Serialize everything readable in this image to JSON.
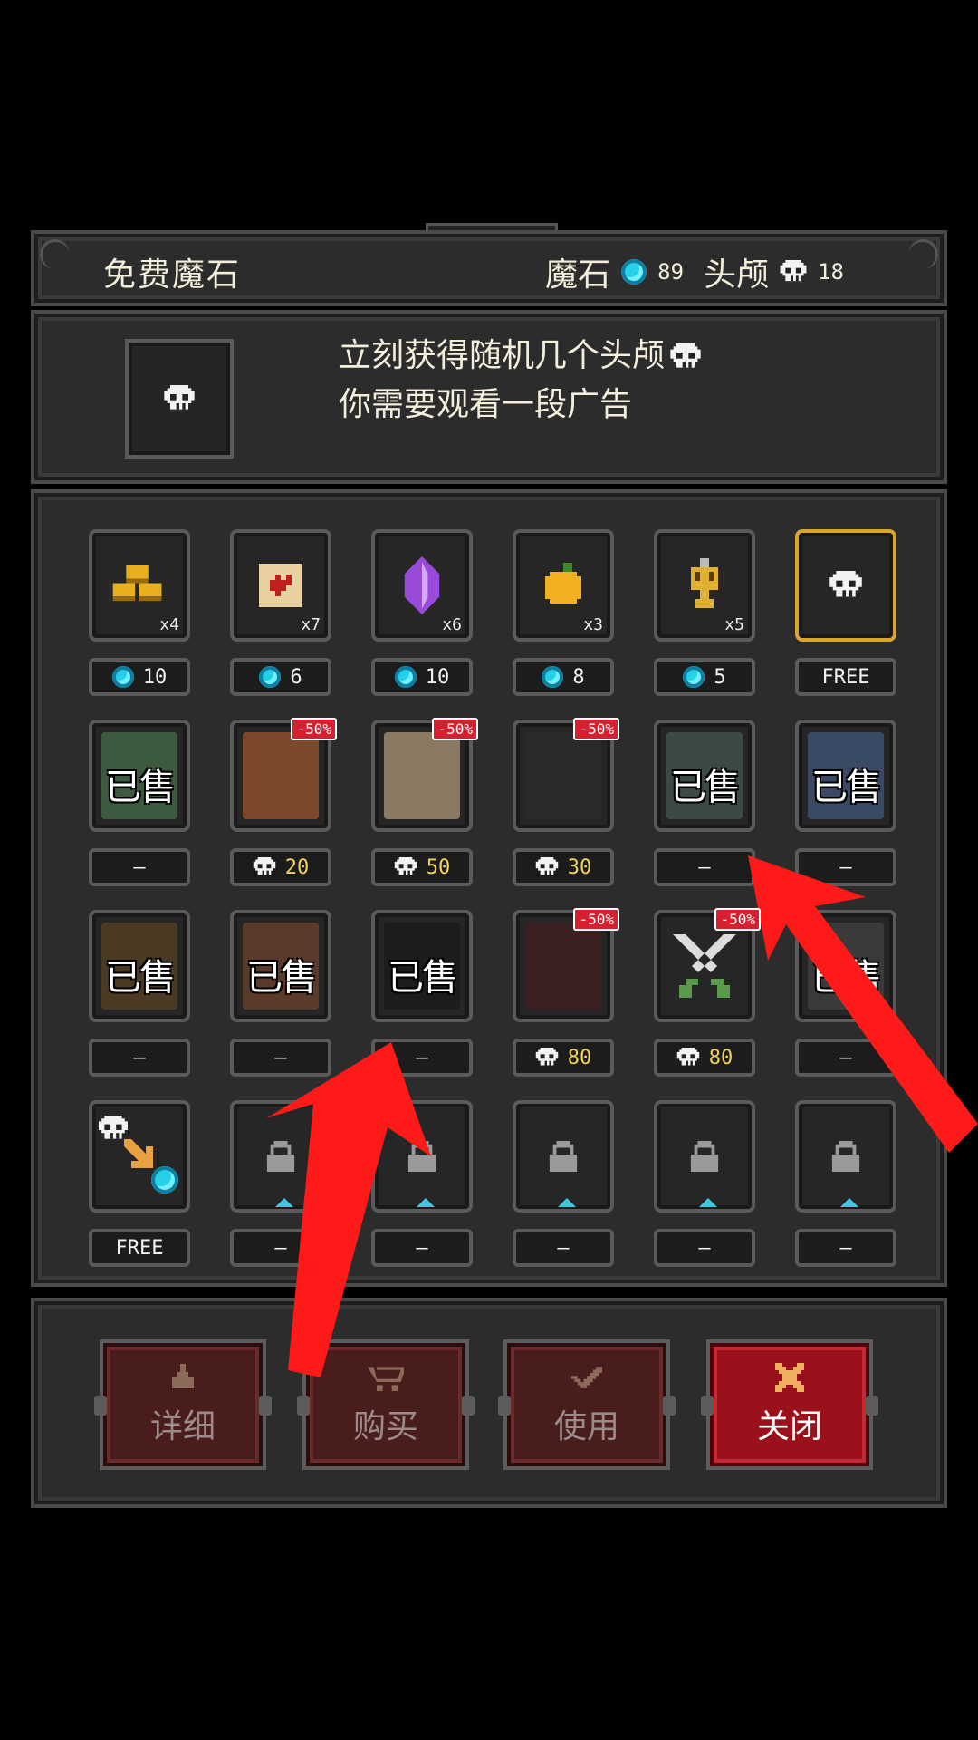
{
  "header": {
    "title": "免费魔石",
    "gem_label": "魔石",
    "gem_count": "89",
    "skull_label": "头颅",
    "skull_count": "18"
  },
  "ad": {
    "line1": "立刻获得随机几个头颅",
    "line2": "你需要观看一段广告"
  },
  "grid": {
    "rows": [
      [
        {
          "icon": "gold-bars-icon",
          "count": "x4",
          "price": "10",
          "currency": "gem"
        },
        {
          "icon": "scroll-heart-icon",
          "count": "x7",
          "price": "6",
          "currency": "gem"
        },
        {
          "icon": "purple-crystal-icon",
          "count": "x6",
          "price": "10",
          "currency": "gem"
        },
        {
          "icon": "golden-apple-icon",
          "count": "x3",
          "price": "8",
          "currency": "gem"
        },
        {
          "icon": "golden-skull-key-icon",
          "count": "x5",
          "price": "5",
          "currency": "gem"
        },
        {
          "icon": "skull-icon",
          "count": "",
          "price": "FREE",
          "currency": "none",
          "selected": true
        }
      ],
      [
        {
          "icon": "green-slime-portrait",
          "sold": "已售",
          "price": "—"
        },
        {
          "icon": "tree-monster-portrait",
          "badge": "-50%",
          "price": "20",
          "currency": "skull"
        },
        {
          "icon": "skeleton-knight-portrait",
          "badge": "-50%",
          "price": "50",
          "currency": "skull"
        },
        {
          "icon": "dark-reaper-portrait",
          "badge": "-50%",
          "price": "30",
          "currency": "skull"
        },
        {
          "icon": "green-haired-girl-portrait",
          "sold": "已售",
          "price": "—"
        },
        {
          "icon": "blue-mage-girl-portrait",
          "sold": "已售",
          "price": "—"
        }
      ],
      [
        {
          "icon": "forest-ent-portrait",
          "sold": "已售",
          "price": "—"
        },
        {
          "icon": "blonde-vampire-portrait",
          "sold": "已售",
          "price": "—"
        },
        {
          "icon": "shadow-wraith-portrait",
          "sold": "已售",
          "price": "—"
        },
        {
          "icon": "pirate-captain-portrait",
          "badge": "-50%",
          "price": "80",
          "currency": "skull"
        },
        {
          "icon": "crossed-swords-icon",
          "badge": "-50%",
          "price": "80",
          "currency": "skull"
        },
        {
          "icon": "hooded-figure-portrait",
          "sold": "已售",
          "price": "—"
        }
      ],
      [
        {
          "icon": "skull-to-gem-exchange-icon",
          "price": "FREE",
          "currency": "none"
        },
        {
          "icon": "lock-icon",
          "locked": true,
          "price": "—"
        },
        {
          "icon": "lock-icon",
          "locked": true,
          "price": "—"
        },
        {
          "icon": "lock-icon",
          "locked": true,
          "price": "—"
        },
        {
          "icon": "lock-icon",
          "locked": true,
          "price": "—"
        },
        {
          "icon": "lock-icon",
          "locked": true,
          "price": "—"
        }
      ]
    ]
  },
  "buttons": {
    "detail": "详细",
    "buy": "购买",
    "use": "使用",
    "close": "关闭"
  },
  "colors": {
    "gem": "#26d0e8",
    "badge": "#d62030",
    "selected_border": "#d9a530",
    "active_button": "#9b111b",
    "arrow": "#ff1a1a"
  }
}
